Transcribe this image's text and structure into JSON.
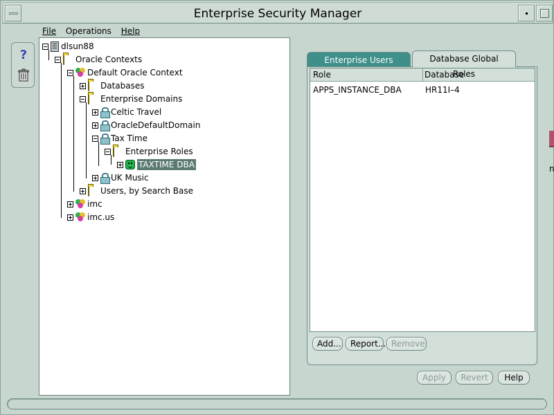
{
  "window": {
    "title": "Enterprise Security Manager"
  },
  "menu": {
    "file": "File",
    "operations": "Operations",
    "help": "Help"
  },
  "toolbar": {
    "help_icon": "?"
  },
  "tree": {
    "root": "dlsun88",
    "oracle_contexts": "Oracle Contexts",
    "default_context": "Default Oracle Context",
    "databases": "Databases",
    "enterprise_domains": "Enterprise Domains",
    "celtic_travel": "Celtic Travel",
    "oracle_default_domain": "OracleDefaultDomain",
    "tax_time": "Tax Time",
    "enterprise_roles": "Enterprise Roles",
    "taxtime_dba": "TAXTIME DBA",
    "uk_music": "UK Music",
    "users_by_search_base": "Users, by Search Base",
    "imc": "imc",
    "imc_us": "imc.us"
  },
  "tabs": {
    "enterprise_users": "Enterprise Users",
    "database_global_roles": "Database Global Roles",
    "active": "Database Global Roles"
  },
  "table": {
    "columns": [
      "Role",
      "Database"
    ],
    "rows": [
      {
        "role": "APPS_INSTANCE_DBA",
        "database": "HR11I–4"
      }
    ]
  },
  "buttons": {
    "add": "Add...",
    "report": "Report...",
    "remove": "Remove",
    "apply": "Apply",
    "revert": "Revert",
    "help": "Help"
  },
  "edge": {
    "glyph": "n"
  },
  "colors": {
    "window_bg": "#c7d6cf",
    "selection": "#5b7a74",
    "active_tab": "#3f8f8a",
    "folder": "#f3d83a"
  },
  "icons": [
    "menu-icon",
    "minimize-icon",
    "maximize-icon",
    "help-icon",
    "trash-icon",
    "server-icon",
    "folder-icon",
    "oracle-context-icon",
    "domain-lock-icon",
    "role-icon"
  ]
}
